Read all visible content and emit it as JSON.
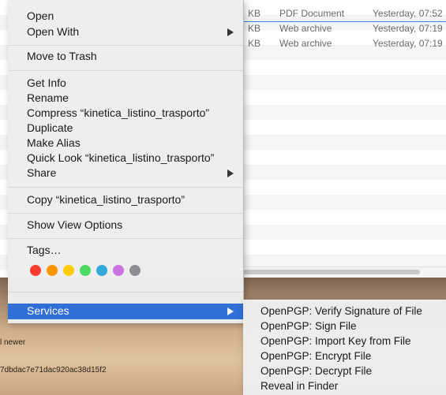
{
  "finder_rows": [
    {
      "size": "KB",
      "kind": "PDF Document",
      "date": "Yesterday, 07:52"
    },
    {
      "size": "KB",
      "kind": "Web archive",
      "date": "Yesterday, 07:19"
    },
    {
      "size": "KB",
      "kind": "Web archive",
      "date": "Yesterday, 07:19"
    }
  ],
  "context_menu": {
    "open": "Open",
    "open_with": "Open With",
    "move_to_trash": "Move to Trash",
    "get_info": "Get Info",
    "rename": "Rename",
    "compress": "Compress “kinetica_listino_trasporto”",
    "duplicate": "Duplicate",
    "make_alias": "Make Alias",
    "quick_look": "Quick Look “kinetica_listino_trasporto”",
    "share": "Share",
    "copy": "Copy “kinetica_listino_trasporto”",
    "show_view_options": "Show View Options",
    "tags": "Tags…",
    "services": "Services",
    "tag_colors": [
      "#ff3b30",
      "#ff9500",
      "#ffcc00",
      "#4cd964",
      "#34aadc",
      "#cc73e1",
      "#8e8e93"
    ]
  },
  "services_submenu": {
    "items": [
      "OpenPGP: Verify Signature of File",
      "OpenPGP: Sign File",
      "OpenPGP: Import Key from File",
      "OpenPGP: Encrypt File",
      "OpenPGP: Decrypt File",
      "Reveal in Finder"
    ]
  },
  "desktop": {
    "text_newer": "l newer",
    "text_hash": "7dbdac7e71dac920ac38d15f2"
  },
  "colors": {
    "highlight": "#2f6fd6",
    "menu_bg": "#eeeeee"
  }
}
